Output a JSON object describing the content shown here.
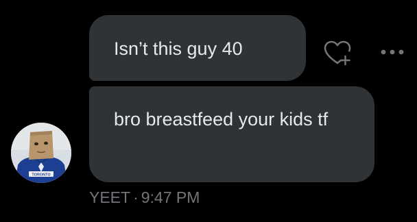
{
  "messages": [
    {
      "text": "Isn’t this guy 40"
    },
    {
      "text": "bro breastfeed your kids tf"
    }
  ],
  "sender": {
    "name": "YEET",
    "time": "9:47 PM",
    "separator": "·",
    "avatar_shirt_text": "TORONTO"
  },
  "icons": {
    "react": "heart-plus-icon",
    "more": "more-horizontal-icon"
  },
  "colors": {
    "background": "#000000",
    "bubble": "#2f3336",
    "text": "#e7e9ea",
    "muted": "#71767b"
  }
}
